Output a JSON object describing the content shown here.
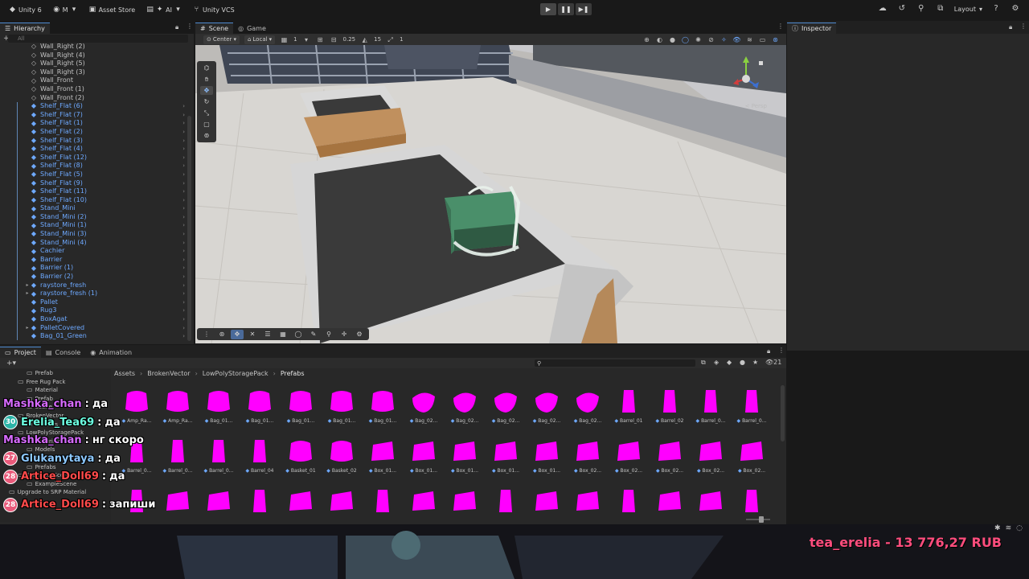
{
  "toolbar": {
    "app": "Unity 6",
    "account": "M",
    "asset_store": "Asset Store",
    "ai": "AI",
    "vcs": "Unity VCS",
    "layout": "Layout"
  },
  "hierarchy": {
    "tab": "Hierarchy",
    "search_placeholder": "All",
    "items": [
      {
        "label": "Wall_Right (2)",
        "type": "go"
      },
      {
        "label": "Wall_Right (4)",
        "type": "go"
      },
      {
        "label": "Wall_Right (5)",
        "type": "go"
      },
      {
        "label": "Wall_Right (3)",
        "type": "go"
      },
      {
        "label": "Wall_Front",
        "type": "go"
      },
      {
        "label": "Wall_Front (1)",
        "type": "go"
      },
      {
        "label": "Wall_Front (2)",
        "type": "go"
      },
      {
        "label": "Shelf_Flat (6)",
        "type": "prefab"
      },
      {
        "label": "Shelf_Flat (7)",
        "type": "prefab"
      },
      {
        "label": "Shelf_Flat (1)",
        "type": "prefab"
      },
      {
        "label": "Shelf_Flat (2)",
        "type": "prefab"
      },
      {
        "label": "Shelf_Flat (3)",
        "type": "prefab"
      },
      {
        "label": "Shelf_Flat (4)",
        "type": "prefab"
      },
      {
        "label": "Shelf_Flat (12)",
        "type": "prefab"
      },
      {
        "label": "Shelf_Flat (8)",
        "type": "prefab"
      },
      {
        "label": "Shelf_Flat (5)",
        "type": "prefab"
      },
      {
        "label": "Shelf_Flat (9)",
        "type": "prefab"
      },
      {
        "label": "Shelf_Flat (11)",
        "type": "prefab"
      },
      {
        "label": "Shelf_Flat (10)",
        "type": "prefab"
      },
      {
        "label": "Stand_Mini",
        "type": "prefab"
      },
      {
        "label": "Stand_Mini (2)",
        "type": "prefab"
      },
      {
        "label": "Stand_Mini (1)",
        "type": "prefab"
      },
      {
        "label": "Stand_Mini (3)",
        "type": "prefab"
      },
      {
        "label": "Stand_Mini (4)",
        "type": "prefab"
      },
      {
        "label": "Cachier",
        "type": "prefab"
      },
      {
        "label": "Barrier",
        "type": "prefab"
      },
      {
        "label": "Barrier (1)",
        "type": "prefab"
      },
      {
        "label": "Barrier (2)",
        "type": "prefab"
      },
      {
        "label": "raystore_fresh",
        "type": "prefab",
        "expand": true
      },
      {
        "label": "raystore_fresh (1)",
        "type": "prefab",
        "expand": true
      },
      {
        "label": "Pallet",
        "type": "prefab"
      },
      {
        "label": "Rug3",
        "type": "prefab"
      },
      {
        "label": "BoxAgat",
        "type": "prefab"
      },
      {
        "label": "PalletCovered",
        "type": "prefab",
        "expand": true
      },
      {
        "label": "Bag_01_Green",
        "type": "prefab"
      }
    ]
  },
  "scene": {
    "tabs": [
      "Scene",
      "Game"
    ],
    "pivot": "Center",
    "space": "Local",
    "grid_val": "1",
    "snap_val": "0.25",
    "rot_val": "15",
    "scale_val": "1",
    "persp_label": "< Persp"
  },
  "inspector": {
    "tab": "Inspector"
  },
  "project": {
    "tabs": [
      "Project",
      "Console",
      "Animation"
    ],
    "count": "21",
    "breadcrumb": [
      "Assets",
      "BrokenVector",
      "LowPolyStoragePack",
      "Prefabs"
    ],
    "tree": [
      {
        "label": "Prefab",
        "indent": 3
      },
      {
        "label": "Free Rug Pack",
        "indent": 2
      },
      {
        "label": "Material",
        "indent": 3
      },
      {
        "label": "Prefab",
        "indent": 3
      },
      {
        "label": "Scene",
        "indent": 3
      },
      {
        "label": "BrokenVector",
        "indent": 2
      },
      {
        "label": "Shaders",
        "indent": 3
      },
      {
        "label": "LowPolyStoragePack",
        "indent": 2
      },
      {
        "label": "Materials",
        "indent": 3
      },
      {
        "label": "Models",
        "indent": 3
      },
      {
        "label": "Palettes",
        "indent": 3
      },
      {
        "label": "Prefabs",
        "indent": 3
      },
      {
        "label": "ExamplesScene",
        "indent": 2
      },
      {
        "label": "ExampleScene",
        "indent": 3
      },
      {
        "label": "Upgrade to SRP Material",
        "indent": 1
      }
    ],
    "assets_row1": [
      "Amp_Ra...",
      "Amp_Ra...",
      "Bag_01...",
      "Bag_01...",
      "Bag_01...",
      "Bag_01...",
      "Bag_01...",
      "Bag_02...",
      "Bag_02...",
      "Bag_02...",
      "Bag_02...",
      "Bag_02...",
      "Barrel_01",
      "Barrel_02",
      "Barrel_0...",
      "Barrel_0..."
    ],
    "assets_row2": [
      "Barrel_0...",
      "Barrel_0...",
      "Barrel_0...",
      "Barrel_04",
      "Basket_01",
      "Basket_02",
      "Box_01...",
      "Box_01...",
      "Box_01...",
      "Box_01...",
      "Box_01...",
      "Box_02...",
      "Box_02...",
      "Box_02...",
      "Box_02...",
      "Box_02..."
    ]
  },
  "chat": [
    {
      "badge": "",
      "user": "Mashka_chan",
      "text": "да",
      "color": "#d76bff"
    },
    {
      "badge": "30",
      "user": "Erelia_Tea69",
      "text": "да",
      "color": "#6cffe1",
      "teal": true
    },
    {
      "badge": "",
      "user": "Mashka_chan",
      "text": "нг скоро",
      "color": "#d76bff"
    },
    {
      "badge": "27",
      "user": "Glukanytaya",
      "text": "да",
      "color": "#8cc8ff"
    },
    {
      "badge": "28",
      "user": "Artice_Doll69",
      "text": "да",
      "color": "#ff4a4a"
    },
    {
      "badge": "28",
      "user": "Artice_Doll69",
      "text": "запиши",
      "color": "#ff4a4a"
    }
  ],
  "donation": "tea_erelia - 13 776,27 RUB",
  "colors": {
    "accent": "#4f8bd1",
    "prefab": "#6ea9ff",
    "missing_material": "#ff00ff"
  }
}
